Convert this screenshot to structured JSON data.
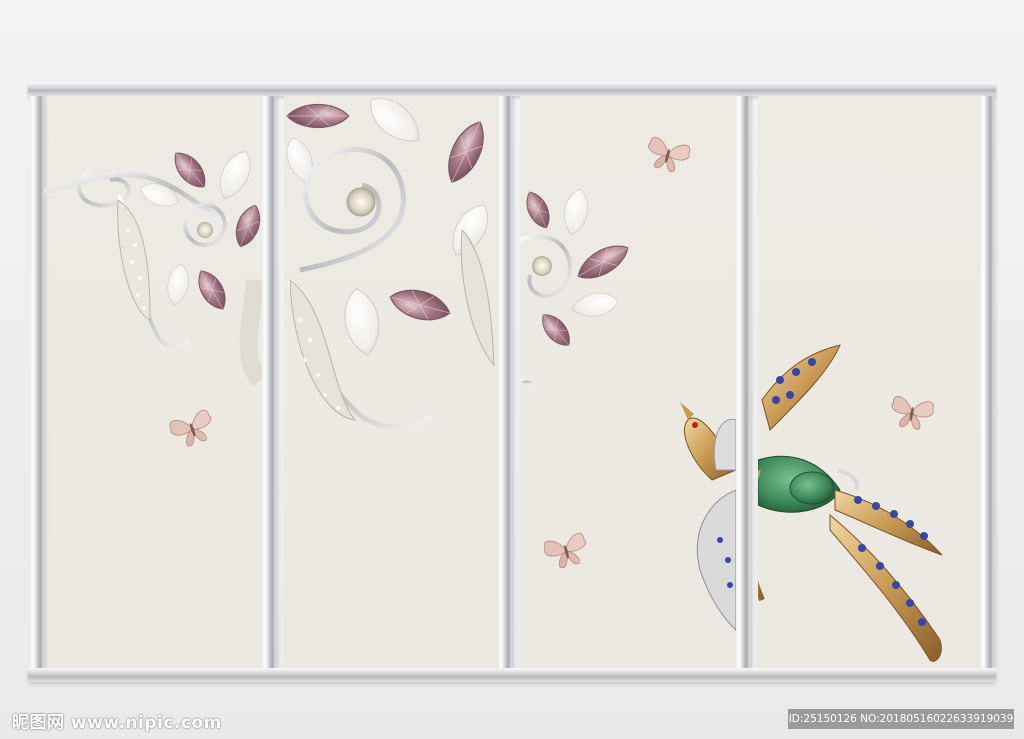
{
  "image": {
    "subject": "four-panel jewelry wall mural",
    "colors": {
      "wall": "#ececec",
      "panel": "#ece9e2",
      "frame_silver": "#c4c5c9",
      "gem_pink": "#a87f8c",
      "petal_white": "#f7f5f2",
      "bird_green": "#3f8a5a",
      "bird_blue": "#3446a8",
      "gold": "#c99a55",
      "butterfly": "#e2bfb6"
    },
    "icons": [
      "butterfly-icon",
      "bird-brooch",
      "flower-gem-branch"
    ]
  },
  "watermark": {
    "left": "昵图网 www.nipic.com",
    "right": "ID:25150126 NO:20180516022633919039"
  }
}
